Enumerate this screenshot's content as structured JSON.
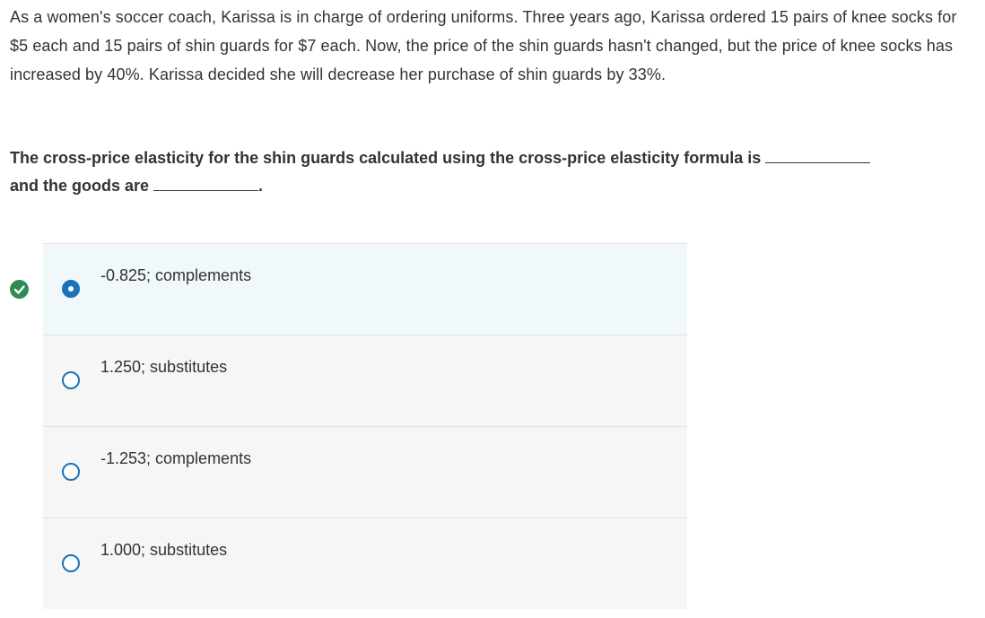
{
  "question": {
    "stem": "As a women's soccer coach, Karissa is in charge of ordering uniforms. Three years ago, Karissa ordered 15 pairs of knee socks for $5 each and 15 pairs of shin guards for $7 each. Now, the price of the shin guards hasn't changed, but the price of knee socks has increased by 40%. Karissa decided she will decrease her purchase of shin guards by 33%.",
    "prompt_part1": "The cross-price elasticity for the shin guards calculated using the cross-price elasticity formula is",
    "prompt_part2": "and the goods are",
    "prompt_end": "."
  },
  "choices": [
    {
      "label": "-0.825; complements",
      "selected": true,
      "correct": true
    },
    {
      "label": "1.250; substitutes",
      "selected": false
    },
    {
      "label": "-1.253; complements",
      "selected": false
    },
    {
      "label": "1.000; substitutes",
      "selected": false
    }
  ],
  "icons": {
    "correct": "check-circle-icon",
    "radio": "radio-button-icon"
  },
  "colors": {
    "accent": "#1a73b8",
    "correct": "#2e8b57",
    "selected_bg": "#f1f8fb",
    "choice_bg": "#f6f6f6"
  }
}
